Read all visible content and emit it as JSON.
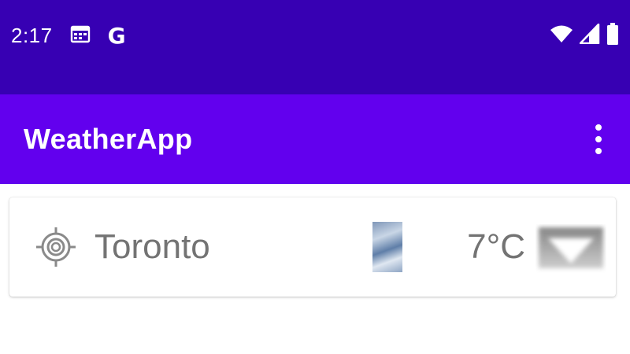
{
  "status_bar": {
    "time": "2:17",
    "notification_icons": [
      "calendar-icon",
      "google-icon"
    ],
    "google_letter": "G",
    "system_icons": [
      "wifi-icon",
      "cell-signal-icon",
      "battery-icon"
    ],
    "background_color": "#3700b3"
  },
  "app_bar": {
    "title": "WeatherApp",
    "menu_icon": "more-vert-icon",
    "background_color": "#6200ee"
  },
  "weather_card": {
    "location_icon": "my-location-icon",
    "city": "Toronto",
    "condition_image": "cloudy-sky-thumbnail",
    "temperature": "7°C",
    "expand_icon": "dropdown-arrow-icon"
  }
}
